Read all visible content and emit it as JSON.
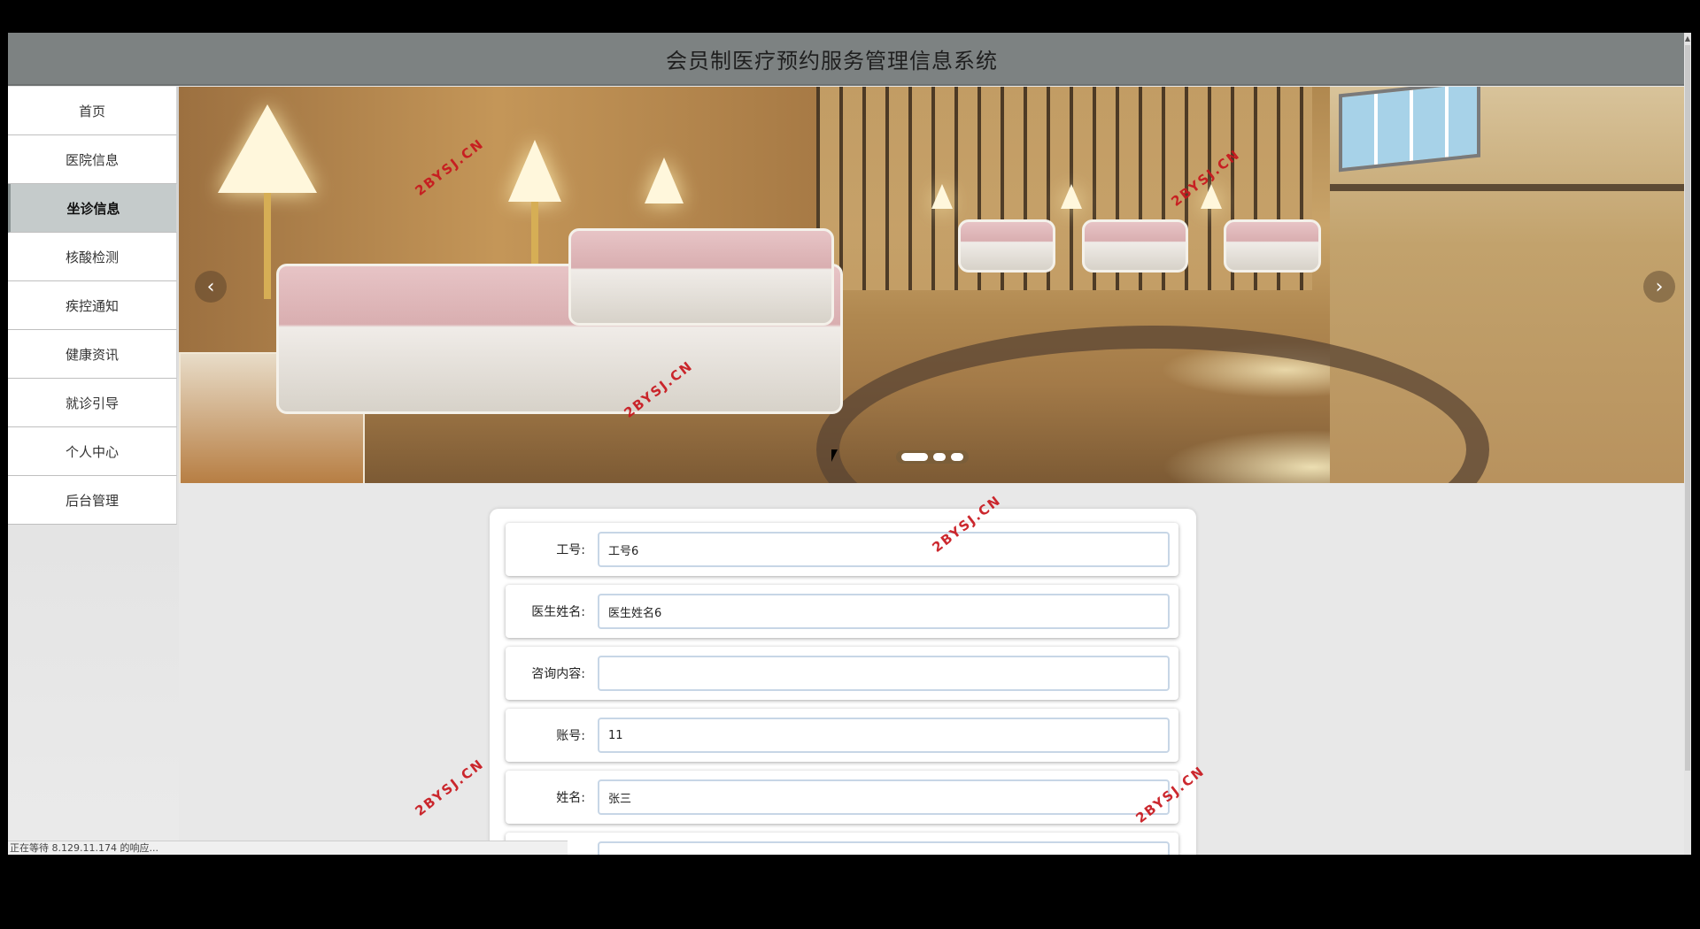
{
  "header": {
    "title": "会员制医疗预约服务管理信息系统"
  },
  "sidebar": {
    "items": [
      {
        "label": "首页",
        "active": false
      },
      {
        "label": "医院信息",
        "active": false
      },
      {
        "label": "坐诊信息",
        "active": true
      },
      {
        "label": "核酸检测",
        "active": false
      },
      {
        "label": "疾控通知",
        "active": false
      },
      {
        "label": "健康资讯",
        "active": false
      },
      {
        "label": "就诊引导",
        "active": false
      },
      {
        "label": "个人中心",
        "active": false
      },
      {
        "label": "后台管理",
        "active": false
      }
    ]
  },
  "carousel": {
    "prev_icon": "chevron-left-icon",
    "next_icon": "chevron-right-icon",
    "slide_count": 3,
    "active_slide": 1,
    "prev_glyph": "‹",
    "next_glyph": "›"
  },
  "form": {
    "fields": [
      {
        "label": "工号:",
        "value": "工号6",
        "placeholder": ""
      },
      {
        "label": "医生姓名:",
        "value": "医生姓名6",
        "placeholder": ""
      },
      {
        "label": "咨询内容:",
        "value": "",
        "placeholder": ""
      },
      {
        "label": "账号:",
        "value": "11",
        "placeholder": ""
      },
      {
        "label": "姓名:",
        "value": "张三",
        "placeholder": ""
      },
      {
        "label": "",
        "value": "",
        "placeholder": ""
      }
    ]
  },
  "watermark": {
    "text": "2BYSJ.CN",
    "color": "#c8161d"
  },
  "status_bar": {
    "text": "正在等待 8.129.11.174 的响应..."
  },
  "colors": {
    "header_bg": "#7d8282",
    "active_nav_bg": "#c5cbcb",
    "page_bg": "#e8e8e8"
  }
}
